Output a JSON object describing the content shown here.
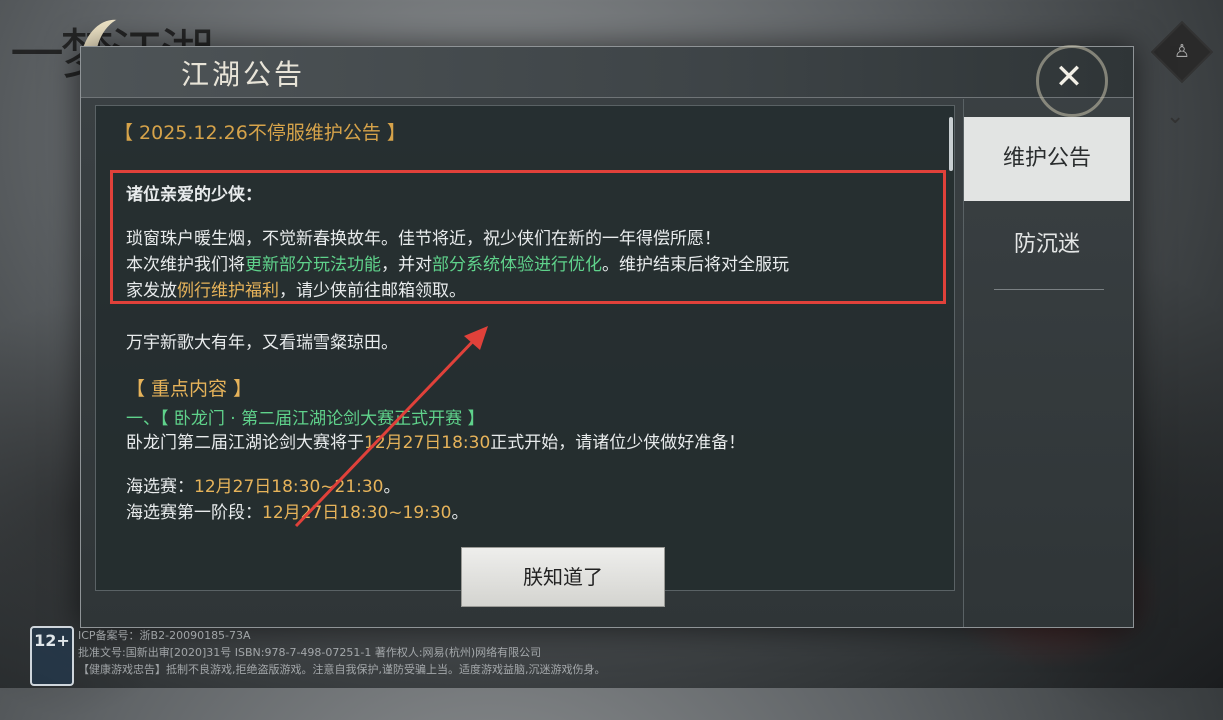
{
  "game_logo": "一梦江湖",
  "dialog": {
    "title": "江湖公告",
    "close_label": "✕"
  },
  "tabs": [
    {
      "label": "维护公告",
      "active": true
    },
    {
      "label": "防沉迷",
      "active": false
    }
  ],
  "notice": {
    "title": "【 2025.12.26不停服维护公告 】",
    "greeting": "诸位亲爱的少侠：",
    "para1": "琐窗珠户暖生烟，不觉新春换故年。佳节将近，祝少侠们在新的一年得偿所愿！",
    "para2_a": "本次维护我们将",
    "para2_b": "更新部分玩法功能",
    "para2_c": "，并对",
    "para2_d": "部分系统体验进行优化",
    "para2_e": "。维护结束后将对全服玩",
    "para3_a": "家发放",
    "para3_b": "例行维护福利",
    "para3_c": "，请少侠前往邮箱领取。",
    "verse": "万宇新歌大有年，又看瑞雪粲琼田。",
    "section_title": "【 重点内容 】",
    "item1_title": "一、【 卧龙门 · 第二届江湖论剑大赛正式开赛 】",
    "item1_body_a": "卧龙门第二届江湖论剑大赛将于",
    "item1_body_b": "12月27日18:30",
    "item1_body_c": "正式开始，请诸位少侠做好准备！",
    "sea_a": "海选赛：",
    "sea_b": "12月27日18:30~21:30",
    "sea_c": "。",
    "stage1_a": "海选赛第一阶段：",
    "stage1_b": "12月27日18:30~19:30",
    "stage1_c": "。"
  },
  "confirm_button": "朕知道了",
  "footer": {
    "age_rating": "12+",
    "icp": "ICP备案号：浙B2-20090185-73A",
    "approval": "批准文号:国新出审[2020]31号  ISBN:978-7-498-07251-1  著作权人:网易(杭州)网络有限公司",
    "health": "【健康游戏忠告】抵制不良游戏,拒绝盗版游戏。注意自我保护,谨防受骗上当。适度游戏益脑,沉迷游戏伤身。"
  },
  "colors": {
    "accent_gold": "#d6a34a",
    "accent_green": "#5fd28b",
    "highlight_red": "#e0413a"
  }
}
